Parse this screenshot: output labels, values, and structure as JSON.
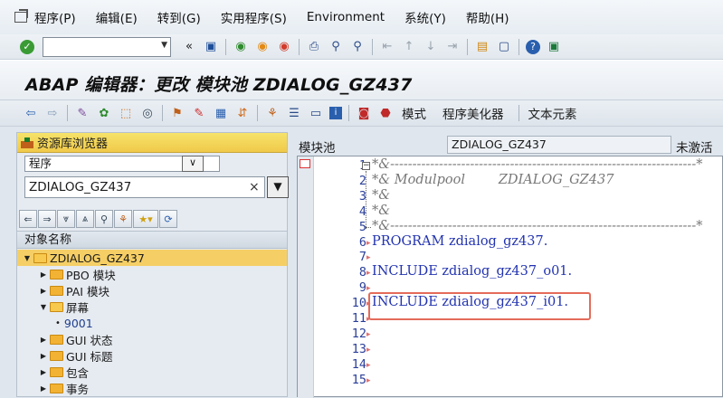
{
  "menu": [
    "程序(P)",
    "编辑(E)",
    "转到(G)",
    "实用程序(S)",
    "Environment",
    "系统(Y)",
    "帮助(H)"
  ],
  "title": "ABAP 编辑器：更改 模块池 ZDIALOG_GZ437",
  "appbar": {
    "mode_label": "模式",
    "beautifier_label": "程序美化器",
    "text_elements_label": "文本元素"
  },
  "navigator": {
    "header": "资源库浏览器",
    "object_type": "程序",
    "object_name": "ZDIALOG_GZ437",
    "tree_header": "对象名称",
    "tree": [
      {
        "label": "ZDIALOG_GZ437",
        "level": 0,
        "expanded": true,
        "selected": true
      },
      {
        "label": "PBO 模块",
        "level": 1,
        "expanded": false
      },
      {
        "label": "PAI 模块",
        "level": 1,
        "expanded": false
      },
      {
        "label": "屏幕",
        "level": 1,
        "expanded": true
      },
      {
        "label": "9001",
        "level": 2,
        "leaf": true
      },
      {
        "label": "GUI 状态",
        "level": 1,
        "expanded": false
      },
      {
        "label": "GUI 标题",
        "level": 1,
        "expanded": false
      },
      {
        "label": "包含",
        "level": 1,
        "expanded": false
      },
      {
        "label": "事务",
        "level": 1,
        "expanded": false
      }
    ]
  },
  "editor": {
    "type_label": "模块池",
    "program": "ZDIALOG_GZ437",
    "status": "未激活",
    "lines": [
      {
        "n": "1",
        "text": "*&---------------------------------------------------------------------*",
        "kind": "cmt"
      },
      {
        "n": "2",
        "text": "*& Modulpool        ZDIALOG_GZ437",
        "kind": "cmt"
      },
      {
        "n": "3",
        "text": "*&",
        "kind": "cmt"
      },
      {
        "n": "4",
        "text": "*&",
        "kind": "cmt"
      },
      {
        "n": "5",
        "text": "*&---------------------------------------------------------------------*",
        "kind": "cmt"
      },
      {
        "n": "6",
        "text": "PROGRAM zdialog_gz437.",
        "kind": "kw"
      },
      {
        "n": "7",
        "text": "",
        "kind": ""
      },
      {
        "n": "8",
        "text": "INCLUDE zdialog_gz437_o01.",
        "kind": "kw"
      },
      {
        "n": "9",
        "text": "",
        "kind": ""
      },
      {
        "n": "10",
        "text": "INCLUDE zdialog_gz437_i01.",
        "kind": "kw"
      },
      {
        "n": "11",
        "text": "",
        "kind": ""
      },
      {
        "n": "12",
        "text": "",
        "kind": ""
      },
      {
        "n": "13",
        "text": "",
        "kind": ""
      },
      {
        "n": "14",
        "text": "",
        "kind": ""
      },
      {
        "n": "15",
        "text": "",
        "kind": ""
      }
    ]
  }
}
